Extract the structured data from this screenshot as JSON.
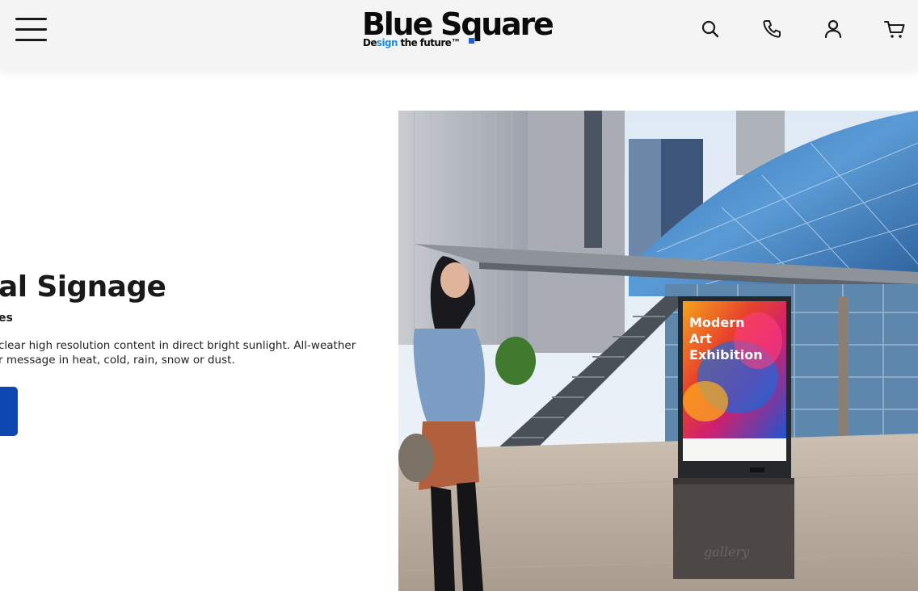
{
  "header": {
    "brand_name": "Blue Square",
    "tagline_prefix": "De",
    "tagline_highlight": "sign",
    "tagline_rest": " the future™",
    "icons": [
      "menu-icon",
      "search-icon",
      "phone-icon",
      "user-icon",
      "cart-icon"
    ]
  },
  "hero": {
    "title": "al Signage",
    "subtitle": "es",
    "description_line1": "clear high resolution content in direct bright sunlight. All-weather",
    "description_line2": "r message in heat, cold, rain, snow or dust."
  },
  "photo": {
    "poster_line1": "Modern",
    "poster_line2": "Art",
    "poster_line3": "Exhibition",
    "kiosk_label": "gallery"
  },
  "colors": {
    "accent": "#0c47b2",
    "tagline_blue": "#1e8ee0",
    "header_bg": "#f4f4f4"
  }
}
